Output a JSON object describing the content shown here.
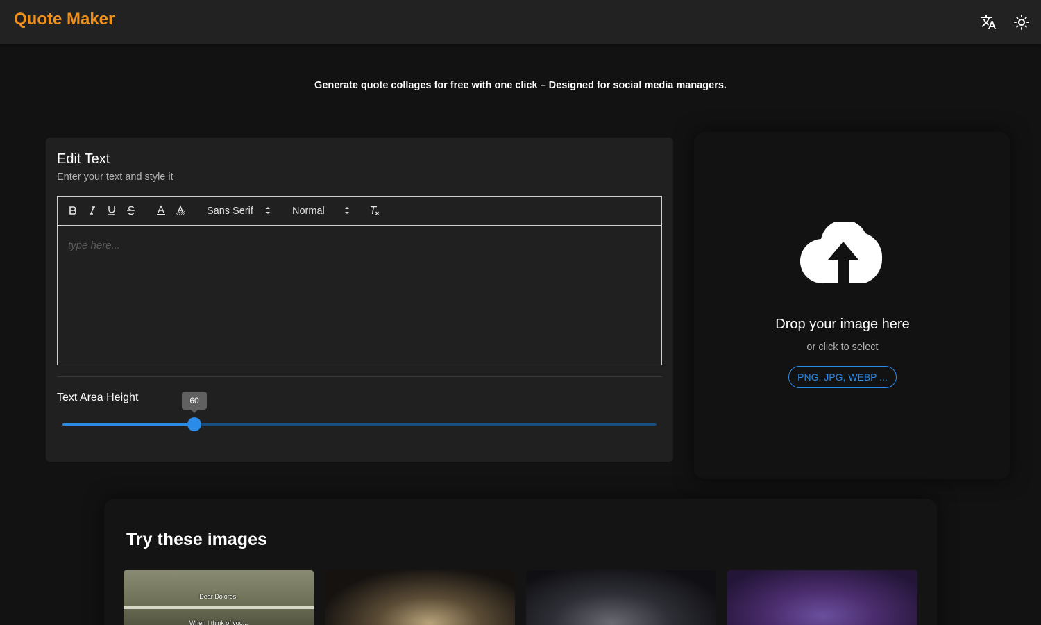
{
  "app": {
    "title": "Quote Maker"
  },
  "header": {
    "icons": [
      "translate-icon",
      "light-mode-icon"
    ]
  },
  "tagline": "Generate quote collages for free with one click – Designed for social media managers.",
  "editor": {
    "title": "Edit Text",
    "subtitle": "Enter your text and style it",
    "toolbar": {
      "font_family": "Sans Serif",
      "font_size": "Normal",
      "buttons": [
        "bold-icon",
        "italic-icon",
        "underline-icon",
        "strikethrough-icon",
        "text-color-icon",
        "background-color-icon",
        "clear-format-icon"
      ]
    },
    "placeholder": "type here...",
    "height_label": "Text Area Height",
    "height_value": "60",
    "height_fraction": 0.222
  },
  "dropzone": {
    "title": "Drop your image here",
    "subtitle": "or click to select",
    "formats": "PNG, JPG, WEBP ..."
  },
  "gallery": {
    "title": "Try these images",
    "images": [
      {
        "captions": [
          "Dear Dolores.",
          "When I think of you..."
        ]
      },
      {
        "captions": []
      },
      {
        "captions": []
      },
      {
        "captions": []
      }
    ]
  },
  "colors": {
    "accent": "#f0901c",
    "primary": "#2b8be8",
    "background": "#121212",
    "surface": "#202020"
  }
}
